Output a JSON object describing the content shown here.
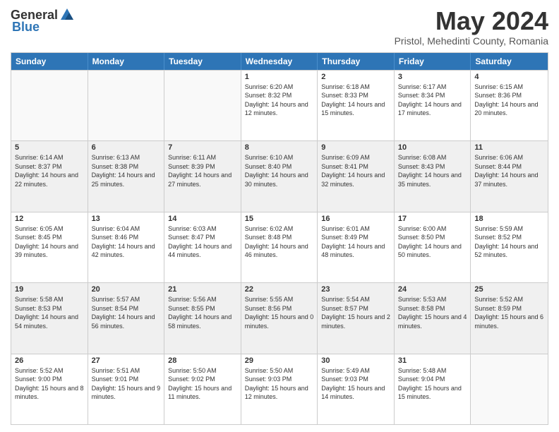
{
  "header": {
    "logo_general": "General",
    "logo_blue": "Blue",
    "month_title": "May 2024",
    "location": "Pristol, Mehedinti County, Romania"
  },
  "days_of_week": [
    "Sunday",
    "Monday",
    "Tuesday",
    "Wednesday",
    "Thursday",
    "Friday",
    "Saturday"
  ],
  "weeks": [
    [
      {
        "day": "",
        "sunrise": "",
        "sunset": "",
        "daylight": "",
        "empty": true
      },
      {
        "day": "",
        "sunrise": "",
        "sunset": "",
        "daylight": "",
        "empty": true
      },
      {
        "day": "",
        "sunrise": "",
        "sunset": "",
        "daylight": "",
        "empty": true
      },
      {
        "day": "1",
        "sunrise": "Sunrise: 6:20 AM",
        "sunset": "Sunset: 8:32 PM",
        "daylight": "Daylight: 14 hours and 12 minutes."
      },
      {
        "day": "2",
        "sunrise": "Sunrise: 6:18 AM",
        "sunset": "Sunset: 8:33 PM",
        "daylight": "Daylight: 14 hours and 15 minutes."
      },
      {
        "day": "3",
        "sunrise": "Sunrise: 6:17 AM",
        "sunset": "Sunset: 8:34 PM",
        "daylight": "Daylight: 14 hours and 17 minutes."
      },
      {
        "day": "4",
        "sunrise": "Sunrise: 6:15 AM",
        "sunset": "Sunset: 8:36 PM",
        "daylight": "Daylight: 14 hours and 20 minutes."
      }
    ],
    [
      {
        "day": "5",
        "sunrise": "Sunrise: 6:14 AM",
        "sunset": "Sunset: 8:37 PM",
        "daylight": "Daylight: 14 hours and 22 minutes."
      },
      {
        "day": "6",
        "sunrise": "Sunrise: 6:13 AM",
        "sunset": "Sunset: 8:38 PM",
        "daylight": "Daylight: 14 hours and 25 minutes."
      },
      {
        "day": "7",
        "sunrise": "Sunrise: 6:11 AM",
        "sunset": "Sunset: 8:39 PM",
        "daylight": "Daylight: 14 hours and 27 minutes."
      },
      {
        "day": "8",
        "sunrise": "Sunrise: 6:10 AM",
        "sunset": "Sunset: 8:40 PM",
        "daylight": "Daylight: 14 hours and 30 minutes."
      },
      {
        "day": "9",
        "sunrise": "Sunrise: 6:09 AM",
        "sunset": "Sunset: 8:41 PM",
        "daylight": "Daylight: 14 hours and 32 minutes."
      },
      {
        "day": "10",
        "sunrise": "Sunrise: 6:08 AM",
        "sunset": "Sunset: 8:43 PM",
        "daylight": "Daylight: 14 hours and 35 minutes."
      },
      {
        "day": "11",
        "sunrise": "Sunrise: 6:06 AM",
        "sunset": "Sunset: 8:44 PM",
        "daylight": "Daylight: 14 hours and 37 minutes."
      }
    ],
    [
      {
        "day": "12",
        "sunrise": "Sunrise: 6:05 AM",
        "sunset": "Sunset: 8:45 PM",
        "daylight": "Daylight: 14 hours and 39 minutes."
      },
      {
        "day": "13",
        "sunrise": "Sunrise: 6:04 AM",
        "sunset": "Sunset: 8:46 PM",
        "daylight": "Daylight: 14 hours and 42 minutes."
      },
      {
        "day": "14",
        "sunrise": "Sunrise: 6:03 AM",
        "sunset": "Sunset: 8:47 PM",
        "daylight": "Daylight: 14 hours and 44 minutes."
      },
      {
        "day": "15",
        "sunrise": "Sunrise: 6:02 AM",
        "sunset": "Sunset: 8:48 PM",
        "daylight": "Daylight: 14 hours and 46 minutes."
      },
      {
        "day": "16",
        "sunrise": "Sunrise: 6:01 AM",
        "sunset": "Sunset: 8:49 PM",
        "daylight": "Daylight: 14 hours and 48 minutes."
      },
      {
        "day": "17",
        "sunrise": "Sunrise: 6:00 AM",
        "sunset": "Sunset: 8:50 PM",
        "daylight": "Daylight: 14 hours and 50 minutes."
      },
      {
        "day": "18",
        "sunrise": "Sunrise: 5:59 AM",
        "sunset": "Sunset: 8:52 PM",
        "daylight": "Daylight: 14 hours and 52 minutes."
      }
    ],
    [
      {
        "day": "19",
        "sunrise": "Sunrise: 5:58 AM",
        "sunset": "Sunset: 8:53 PM",
        "daylight": "Daylight: 14 hours and 54 minutes."
      },
      {
        "day": "20",
        "sunrise": "Sunrise: 5:57 AM",
        "sunset": "Sunset: 8:54 PM",
        "daylight": "Daylight: 14 hours and 56 minutes."
      },
      {
        "day": "21",
        "sunrise": "Sunrise: 5:56 AM",
        "sunset": "Sunset: 8:55 PM",
        "daylight": "Daylight: 14 hours and 58 minutes."
      },
      {
        "day": "22",
        "sunrise": "Sunrise: 5:55 AM",
        "sunset": "Sunset: 8:56 PM",
        "daylight": "Daylight: 15 hours and 0 minutes."
      },
      {
        "day": "23",
        "sunrise": "Sunrise: 5:54 AM",
        "sunset": "Sunset: 8:57 PM",
        "daylight": "Daylight: 15 hours and 2 minutes."
      },
      {
        "day": "24",
        "sunrise": "Sunrise: 5:53 AM",
        "sunset": "Sunset: 8:58 PM",
        "daylight": "Daylight: 15 hours and 4 minutes."
      },
      {
        "day": "25",
        "sunrise": "Sunrise: 5:52 AM",
        "sunset": "Sunset: 8:59 PM",
        "daylight": "Daylight: 15 hours and 6 minutes."
      }
    ],
    [
      {
        "day": "26",
        "sunrise": "Sunrise: 5:52 AM",
        "sunset": "Sunset: 9:00 PM",
        "daylight": "Daylight: 15 hours and 8 minutes."
      },
      {
        "day": "27",
        "sunrise": "Sunrise: 5:51 AM",
        "sunset": "Sunset: 9:01 PM",
        "daylight": "Daylight: 15 hours and 9 minutes."
      },
      {
        "day": "28",
        "sunrise": "Sunrise: 5:50 AM",
        "sunset": "Sunset: 9:02 PM",
        "daylight": "Daylight: 15 hours and 11 minutes."
      },
      {
        "day": "29",
        "sunrise": "Sunrise: 5:50 AM",
        "sunset": "Sunset: 9:03 PM",
        "daylight": "Daylight: 15 hours and 12 minutes."
      },
      {
        "day": "30",
        "sunrise": "Sunrise: 5:49 AM",
        "sunset": "Sunset: 9:03 PM",
        "daylight": "Daylight: 15 hours and 14 minutes."
      },
      {
        "day": "31",
        "sunrise": "Sunrise: 5:48 AM",
        "sunset": "Sunset: 9:04 PM",
        "daylight": "Daylight: 15 hours and 15 minutes."
      },
      {
        "day": "",
        "sunrise": "",
        "sunset": "",
        "daylight": "",
        "empty": true
      }
    ]
  ]
}
